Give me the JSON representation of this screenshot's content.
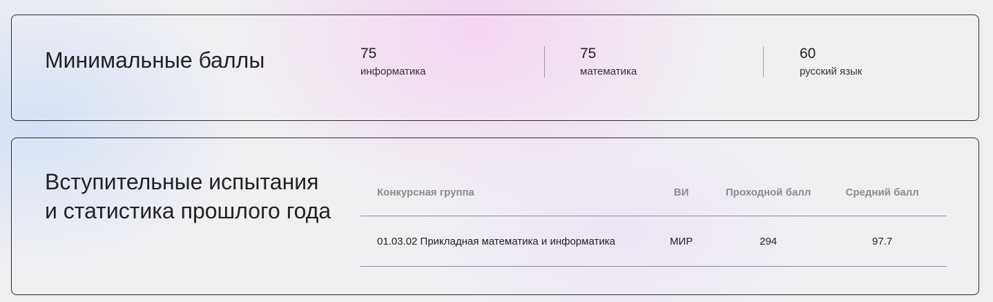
{
  "min_scores": {
    "title": "Минимальные баллы",
    "items": [
      {
        "value": "75",
        "subject": "информатика"
      },
      {
        "value": "75",
        "subject": "математика"
      },
      {
        "value": "60",
        "subject": "русский язык"
      }
    ]
  },
  "entrance": {
    "title_line1": "Вступительные испытания",
    "title_line2": "и статистика прошлого года",
    "columns": {
      "group": "Конкурсная группа",
      "vi": "ВИ",
      "passing": "Проходной балл",
      "average": "Средний балл"
    },
    "rows": [
      {
        "group": "01.03.02 Прикладная математика и информатика",
        "vi": "МИР",
        "passing": "294",
        "average": "97.7"
      }
    ]
  }
}
